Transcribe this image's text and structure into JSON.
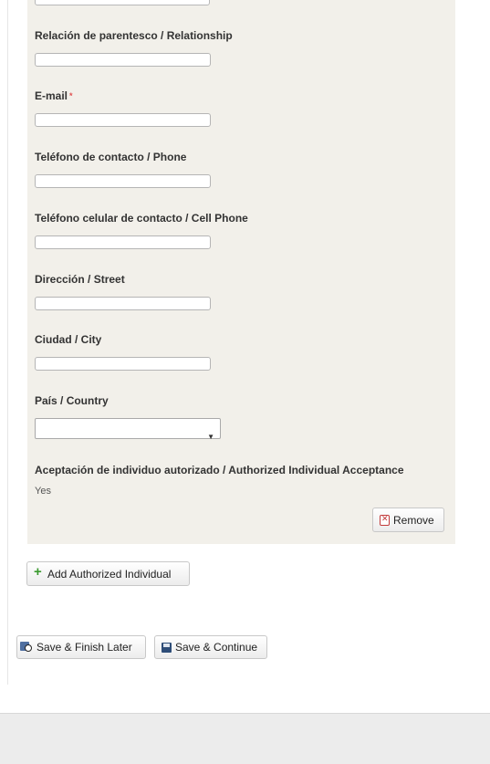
{
  "form": {
    "fields": {
      "relationship": {
        "label": "Relación de parentesco / Relationship",
        "value": ""
      },
      "email": {
        "label": "E-mail",
        "required_mark": "*",
        "value": ""
      },
      "phone": {
        "label": "Teléfono de contacto / Phone",
        "value": ""
      },
      "cell_phone": {
        "label": "Teléfono celular de contacto / Cell Phone",
        "value": ""
      },
      "street": {
        "label": "Dirección / Street",
        "value": ""
      },
      "city": {
        "label": "Ciudad / City",
        "value": ""
      },
      "country": {
        "label": "País / Country",
        "selected": ""
      }
    },
    "acceptance": {
      "label": "Aceptación de individuo autorizado / Authorized Individual Acceptance",
      "value": "Yes"
    },
    "remove_label": "Remove",
    "add_label": "Add Authorized Individual"
  },
  "actions": {
    "save_later_label": "Save & Finish Later",
    "save_continue_label": "Save & Continue"
  },
  "icons": {
    "remove": "remove-icon",
    "add": "plus-icon",
    "save_later": "clock-save-icon",
    "save_continue": "floppy-disk-icon"
  },
  "colors": {
    "panel_bg": "#f2f0ea",
    "required": "#e05050",
    "add_icon": "#3a9a2f",
    "remove_icon": "#c23b3b"
  }
}
